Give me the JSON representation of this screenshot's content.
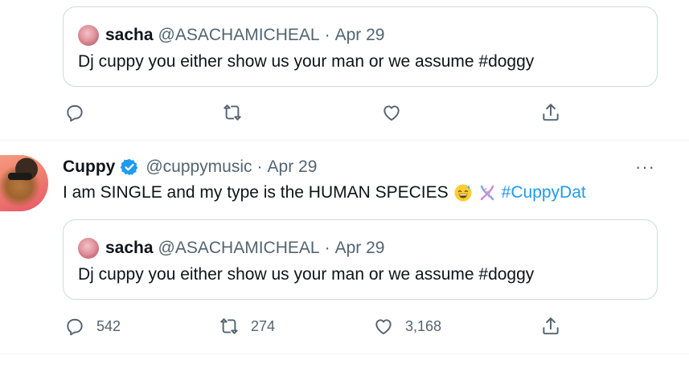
{
  "top_quote": {
    "name": "sacha",
    "handle": "@ASACHAMICHEAL",
    "separator": "·",
    "date": "Apr 29",
    "text": "Dj cuppy you either show us your man or we assume #doggy"
  },
  "top_actions": {
    "reply_icon": "reply-icon",
    "retweet_icon": "retweet-icon",
    "like_icon": "heart-icon",
    "share_icon": "share-icon"
  },
  "tweet": {
    "name": "Cuppy",
    "verified": true,
    "handle": "@cuppymusic",
    "separator": "·",
    "date": "Apr 29",
    "more": "···",
    "text": "I am SINGLE and my type is the HUMAN SPECIES",
    "emojis": [
      "grinning-sweat-emoji",
      "dna-emoji"
    ],
    "hashtag": "#CuppyDat",
    "quote": {
      "name": "sacha",
      "handle": "@ASACHAMICHEAL",
      "separator": "·",
      "date": "Apr 29",
      "text": "Dj cuppy you either show us your man or we assume #doggy"
    },
    "stats": {
      "replies": "542",
      "retweets": "274",
      "likes": "3,168"
    }
  },
  "colors": {
    "link": "#1d9bf0",
    "secondary_text": "#536471",
    "border": "#cfd9de",
    "verified": "#1d9bf0"
  }
}
